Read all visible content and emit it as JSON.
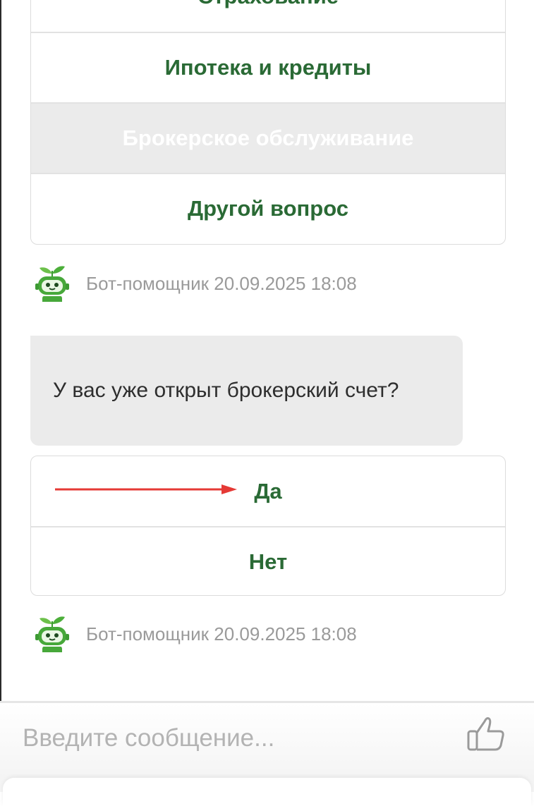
{
  "colors": {
    "accent_green": "#2a6a35",
    "disabled_bg": "#ebebeb",
    "meta_gray": "#9a9a9a",
    "annotation_red": "#e53935"
  },
  "topic_options": [
    {
      "label": "Страхование",
      "state": "normal"
    },
    {
      "label": "Ипотека и кредиты",
      "state": "normal"
    },
    {
      "label": "Брокерское обслуживание",
      "state": "selected-disabled"
    },
    {
      "label": "Другой вопрос",
      "state": "normal"
    }
  ],
  "bot_header_1": {
    "author": "Бот-помощник",
    "timestamp": "20.09.2025 18:08",
    "avatar_icon": "robot-sprout-icon"
  },
  "bot_message": {
    "text": "У вас уже открыт брокерский счет?"
  },
  "answer_options": [
    {
      "label": "Да"
    },
    {
      "label": "Нет"
    }
  ],
  "bot_header_2": {
    "author": "Бот-помощник",
    "timestamp": "20.09.2025 18:08",
    "avatar_icon": "robot-sprout-icon"
  },
  "composer": {
    "placeholder": "Введите сообщение...",
    "value": "",
    "action_icon": "thumbs-up-icon"
  }
}
